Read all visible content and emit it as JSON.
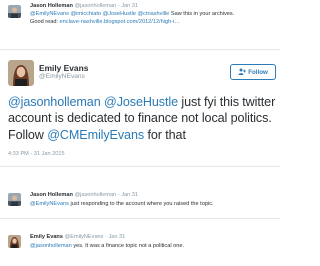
{
  "tweet1": {
    "name": "Jason Holleman",
    "handle": "@jasonholleman",
    "time": "· Jan 31",
    "mentions": "@EmilyNEvans @imicchiato @JoseHustle @ctnashville",
    "text_rest": " Saw this in your archives.",
    "line2_prefix": "Good read: ",
    "link": "enclave-nashville.blogspot.com/2012/12/high-i…"
  },
  "main_tweet": {
    "name": "Emily Evans",
    "handle": "@EmilyNEvans",
    "follow_label": "Follow",
    "mention1": "@jasonholleman",
    "mention2": "@JoseHustle",
    "text_mid": " just fyi this twitter account is dedicated to finance not local politics. Follow ",
    "mention3": "@CMEmilyEvans",
    "text_end": " for that",
    "timestamp": "4:33 PM - 31 Jan 2015"
  },
  "tweet3": {
    "name": "Jason Holleman",
    "handle": "@jasonholleman",
    "time": "· Jan 31",
    "mention": "@EmilyNEvans",
    "text": " just responding to the account where you raised the topic."
  },
  "tweet4": {
    "name": "Emily Evans",
    "handle": "@EmilyNEvans",
    "time": "· Jan 31",
    "mention": "@jasonholleman",
    "text": " yes. It was a finance topic not a political one."
  },
  "colors": {
    "link": "#2b7bb9",
    "muted": "#8899a6",
    "divider": "#e1e8ed"
  },
  "icons": [
    "jason-avatar",
    "emily-avatar",
    "follow-person-icon"
  ]
}
